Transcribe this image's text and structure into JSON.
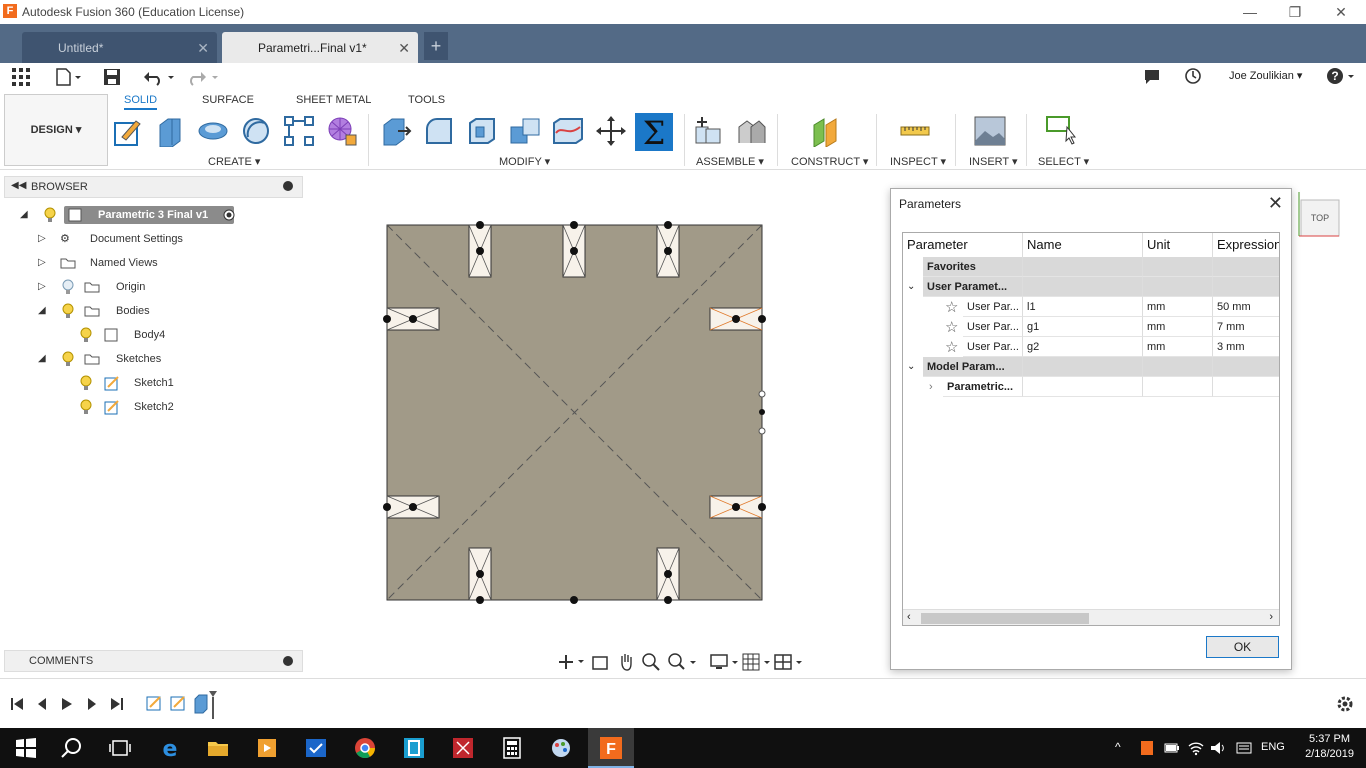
{
  "window": {
    "title": "Autodesk Fusion 360 (Education License)"
  },
  "tabs": [
    {
      "label": "Untitled*"
    },
    {
      "label": "Parametri...Final v1*"
    }
  ],
  "qat": {
    "user": "Joe Zoulikian"
  },
  "ribbon": {
    "design": "DESIGN",
    "tabs": [
      "SOLID",
      "SURFACE",
      "SHEET METAL",
      "TOOLS"
    ],
    "groups": [
      "CREATE",
      "MODIFY",
      "ASSEMBLE",
      "CONSTRUCT",
      "INSPECT",
      "INSERT",
      "SELECT"
    ]
  },
  "browser": {
    "title": "BROWSER",
    "root": "Parametric 3 Final v1",
    "items": [
      "Document Settings",
      "Named Views",
      "Origin",
      "Bodies",
      "Body4",
      "Sketches",
      "Sketch1",
      "Sketch2"
    ]
  },
  "comments": {
    "title": "COMMENTS"
  },
  "viewcube": {
    "label": "TOP"
  },
  "dialog": {
    "title": "Parameters",
    "headers": [
      "Parameter",
      "Name",
      "Unit",
      "Expression"
    ],
    "favorites": "Favorites",
    "user_group": "User Paramet...",
    "user_params": [
      {
        "param": "User Par...",
        "name": "l1",
        "unit": "mm",
        "expr": "50 mm"
      },
      {
        "param": "User Par...",
        "name": "g1",
        "unit": "mm",
        "expr": "7 mm"
      },
      {
        "param": "User Par...",
        "name": "g2",
        "unit": "mm",
        "expr": "3 mm"
      }
    ],
    "model_group": "Model Param...",
    "model_child": "Parametric...",
    "ok": "OK"
  },
  "taskbar": {
    "time": "5:37 PM",
    "date": "2/18/2019",
    "lang": "ENG"
  }
}
